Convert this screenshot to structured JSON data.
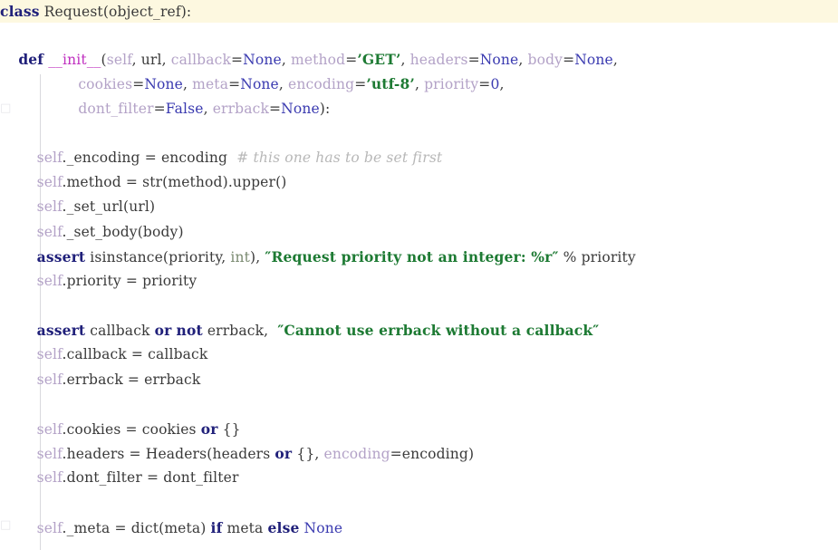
{
  "editor": {
    "language": "python",
    "highlighted_line_number": 1,
    "colors": {
      "background": "#ffffff",
      "current_line_highlight": "#fdf8e0",
      "keyword": "#20207a",
      "string": "#1d7a33",
      "constant": "#3a3ab0",
      "self_param": "#b3a2c7",
      "function_name": "#c030c0",
      "comment": "#b8b8b8",
      "type_name": "#7a8a70",
      "plain_text": "#3a3a3a",
      "indent_guide": "#d9d9dd"
    },
    "gutter_ghosts": [
      "□",
      "□"
    ]
  },
  "code": {
    "lines": [
      {
        "id": "line-class-request",
        "highlighted": true,
        "tokens": [
          {
            "cls": "t-kw",
            "text": "class"
          },
          {
            "cls": "t-op",
            "text": " "
          },
          {
            "cls": "t-name",
            "text": "Request"
          },
          {
            "cls": "t-punct",
            "text": "("
          },
          {
            "cls": "t-name",
            "text": "object_ref"
          },
          {
            "cls": "t-punct",
            "text": "):"
          }
        ]
      },
      {
        "id": "line-blank-1",
        "tokens": []
      },
      {
        "id": "line-def-init",
        "tokens": [
          {
            "cls": "t-op",
            "text": "    "
          },
          {
            "cls": "t-kw",
            "text": "def"
          },
          {
            "cls": "t-op",
            "text": " "
          },
          {
            "cls": "t-fname",
            "text": "__init__"
          },
          {
            "cls": "t-punct",
            "text": "("
          },
          {
            "cls": "t-self",
            "text": "self"
          },
          {
            "cls": "t-punct",
            "text": ", "
          },
          {
            "cls": "t-name",
            "text": "url"
          },
          {
            "cls": "t-punct",
            "text": ", "
          },
          {
            "cls": "t-kwarg",
            "text": "callback"
          },
          {
            "cls": "t-op",
            "text": "="
          },
          {
            "cls": "t-const",
            "text": "None"
          },
          {
            "cls": "t-punct",
            "text": ", "
          },
          {
            "cls": "t-kwarg",
            "text": "method"
          },
          {
            "cls": "t-op",
            "text": "="
          },
          {
            "cls": "t-str",
            "text": "’GET’"
          },
          {
            "cls": "t-punct",
            "text": ", "
          },
          {
            "cls": "t-kwarg",
            "text": "headers"
          },
          {
            "cls": "t-op",
            "text": "="
          },
          {
            "cls": "t-const",
            "text": "None"
          },
          {
            "cls": "t-punct",
            "text": ", "
          },
          {
            "cls": "t-kwarg",
            "text": "body"
          },
          {
            "cls": "t-op",
            "text": "="
          },
          {
            "cls": "t-const",
            "text": "None"
          },
          {
            "cls": "t-punct",
            "text": ","
          }
        ]
      },
      {
        "id": "line-def-init-cont-1",
        "tokens": [
          {
            "cls": "t-op",
            "text": "                 "
          },
          {
            "cls": "t-kwarg",
            "text": "cookies"
          },
          {
            "cls": "t-op",
            "text": "="
          },
          {
            "cls": "t-const",
            "text": "None"
          },
          {
            "cls": "t-punct",
            "text": ", "
          },
          {
            "cls": "t-kwarg",
            "text": "meta"
          },
          {
            "cls": "t-op",
            "text": "="
          },
          {
            "cls": "t-const",
            "text": "None"
          },
          {
            "cls": "t-punct",
            "text": ", "
          },
          {
            "cls": "t-kwarg",
            "text": "encoding"
          },
          {
            "cls": "t-op",
            "text": "="
          },
          {
            "cls": "t-str",
            "text": "’utf-8’"
          },
          {
            "cls": "t-punct",
            "text": ", "
          },
          {
            "cls": "t-kwarg",
            "text": "priority"
          },
          {
            "cls": "t-op",
            "text": "="
          },
          {
            "cls": "t-num",
            "text": "0"
          },
          {
            "cls": "t-punct",
            "text": ","
          }
        ]
      },
      {
        "id": "line-def-init-cont-2",
        "tokens": [
          {
            "cls": "t-op",
            "text": "                 "
          },
          {
            "cls": "t-kwarg",
            "text": "dont_filter"
          },
          {
            "cls": "t-op",
            "text": "="
          },
          {
            "cls": "t-const",
            "text": "False"
          },
          {
            "cls": "t-punct",
            "text": ", "
          },
          {
            "cls": "t-kwarg",
            "text": "errback"
          },
          {
            "cls": "t-op",
            "text": "="
          },
          {
            "cls": "t-const",
            "text": "None"
          },
          {
            "cls": "t-punct",
            "text": "):"
          }
        ]
      },
      {
        "id": "line-blank-2",
        "tokens": []
      },
      {
        "id": "line-self-encoding",
        "tokens": [
          {
            "cls": "t-op",
            "text": "        "
          },
          {
            "cls": "t-self",
            "text": "self"
          },
          {
            "cls": "t-punct",
            "text": "."
          },
          {
            "cls": "t-name",
            "text": "_encoding"
          },
          {
            "cls": "t-op",
            "text": " = "
          },
          {
            "cls": "t-name",
            "text": "encoding"
          },
          {
            "cls": "t-op",
            "text": "  "
          },
          {
            "cls": "t-comment",
            "text": "# this one has to be set first"
          }
        ]
      },
      {
        "id": "line-self-method",
        "tokens": [
          {
            "cls": "t-op",
            "text": "        "
          },
          {
            "cls": "t-self",
            "text": "self"
          },
          {
            "cls": "t-punct",
            "text": "."
          },
          {
            "cls": "t-name",
            "text": "method"
          },
          {
            "cls": "t-op",
            "text": " = "
          },
          {
            "cls": "t-builtin",
            "text": "str"
          },
          {
            "cls": "t-punct",
            "text": "("
          },
          {
            "cls": "t-name",
            "text": "method"
          },
          {
            "cls": "t-punct",
            "text": ")."
          },
          {
            "cls": "t-name",
            "text": "upper"
          },
          {
            "cls": "t-punct",
            "text": "()"
          }
        ]
      },
      {
        "id": "line-self-set-url",
        "tokens": [
          {
            "cls": "t-op",
            "text": "        "
          },
          {
            "cls": "t-self",
            "text": "self"
          },
          {
            "cls": "t-punct",
            "text": "."
          },
          {
            "cls": "t-name",
            "text": "_set_url"
          },
          {
            "cls": "t-punct",
            "text": "("
          },
          {
            "cls": "t-name",
            "text": "url"
          },
          {
            "cls": "t-punct",
            "text": ")"
          }
        ]
      },
      {
        "id": "line-self-set-body",
        "tokens": [
          {
            "cls": "t-op",
            "text": "        "
          },
          {
            "cls": "t-self",
            "text": "self"
          },
          {
            "cls": "t-punct",
            "text": "."
          },
          {
            "cls": "t-name",
            "text": "_set_body"
          },
          {
            "cls": "t-punct",
            "text": "("
          },
          {
            "cls": "t-name",
            "text": "body"
          },
          {
            "cls": "t-punct",
            "text": ")"
          }
        ]
      },
      {
        "id": "line-assert-priority",
        "tokens": [
          {
            "cls": "t-op",
            "text": "        "
          },
          {
            "cls": "t-kw",
            "text": "assert"
          },
          {
            "cls": "t-op",
            "text": " "
          },
          {
            "cls": "t-builtin",
            "text": "isinstance"
          },
          {
            "cls": "t-punct",
            "text": "("
          },
          {
            "cls": "t-name",
            "text": "priority"
          },
          {
            "cls": "t-punct",
            "text": ", "
          },
          {
            "cls": "t-type",
            "text": "int"
          },
          {
            "cls": "t-punct",
            "text": "), "
          },
          {
            "cls": "t-str",
            "text": "″Request priority not an integer: %r″"
          },
          {
            "cls": "t-op",
            "text": " % "
          },
          {
            "cls": "t-name",
            "text": "priority"
          }
        ]
      },
      {
        "id": "line-self-priority",
        "tokens": [
          {
            "cls": "t-op",
            "text": "        "
          },
          {
            "cls": "t-self",
            "text": "self"
          },
          {
            "cls": "t-punct",
            "text": "."
          },
          {
            "cls": "t-name",
            "text": "priority"
          },
          {
            "cls": "t-op",
            "text": " = "
          },
          {
            "cls": "t-name",
            "text": "priority"
          }
        ]
      },
      {
        "id": "line-blank-3",
        "tokens": []
      },
      {
        "id": "line-assert-callback",
        "tokens": [
          {
            "cls": "t-op",
            "text": "        "
          },
          {
            "cls": "t-kw",
            "text": "assert"
          },
          {
            "cls": "t-op",
            "text": " "
          },
          {
            "cls": "t-name",
            "text": "callback"
          },
          {
            "cls": "t-op",
            "text": " "
          },
          {
            "cls": "t-kw",
            "text": "or"
          },
          {
            "cls": "t-op",
            "text": " "
          },
          {
            "cls": "t-kw",
            "text": "not"
          },
          {
            "cls": "t-op",
            "text": " "
          },
          {
            "cls": "t-name",
            "text": "errback"
          },
          {
            "cls": "t-punct",
            "text": ",  "
          },
          {
            "cls": "t-str",
            "text": "″Cannot use errback without a callback″"
          }
        ]
      },
      {
        "id": "line-self-callback",
        "tokens": [
          {
            "cls": "t-op",
            "text": "        "
          },
          {
            "cls": "t-self",
            "text": "self"
          },
          {
            "cls": "t-punct",
            "text": "."
          },
          {
            "cls": "t-name",
            "text": "callback"
          },
          {
            "cls": "t-op",
            "text": " = "
          },
          {
            "cls": "t-name",
            "text": "callback"
          }
        ]
      },
      {
        "id": "line-self-errback",
        "tokens": [
          {
            "cls": "t-op",
            "text": "        "
          },
          {
            "cls": "t-self",
            "text": "self"
          },
          {
            "cls": "t-punct",
            "text": "."
          },
          {
            "cls": "t-name",
            "text": "errback"
          },
          {
            "cls": "t-op",
            "text": " = "
          },
          {
            "cls": "t-name",
            "text": "errback"
          }
        ]
      },
      {
        "id": "line-blank-4",
        "tokens": []
      },
      {
        "id": "line-self-cookies",
        "tokens": [
          {
            "cls": "t-op",
            "text": "        "
          },
          {
            "cls": "t-self",
            "text": "self"
          },
          {
            "cls": "t-punct",
            "text": "."
          },
          {
            "cls": "t-name",
            "text": "cookies"
          },
          {
            "cls": "t-op",
            "text": " = "
          },
          {
            "cls": "t-name",
            "text": "cookies"
          },
          {
            "cls": "t-op",
            "text": " "
          },
          {
            "cls": "t-kw",
            "text": "or"
          },
          {
            "cls": "t-op",
            "text": " "
          },
          {
            "cls": "t-punct",
            "text": "{}"
          }
        ]
      },
      {
        "id": "line-self-headers",
        "tokens": [
          {
            "cls": "t-op",
            "text": "        "
          },
          {
            "cls": "t-self",
            "text": "self"
          },
          {
            "cls": "t-punct",
            "text": "."
          },
          {
            "cls": "t-name",
            "text": "headers"
          },
          {
            "cls": "t-op",
            "text": " = "
          },
          {
            "cls": "t-name",
            "text": "Headers"
          },
          {
            "cls": "t-punct",
            "text": "("
          },
          {
            "cls": "t-name",
            "text": "headers"
          },
          {
            "cls": "t-op",
            "text": " "
          },
          {
            "cls": "t-kw",
            "text": "or"
          },
          {
            "cls": "t-op",
            "text": " "
          },
          {
            "cls": "t-punct",
            "text": "{}, "
          },
          {
            "cls": "t-kwarg",
            "text": "encoding"
          },
          {
            "cls": "t-op",
            "text": "="
          },
          {
            "cls": "t-name",
            "text": "encoding"
          },
          {
            "cls": "t-punct",
            "text": ")"
          }
        ]
      },
      {
        "id": "line-self-dont-filter",
        "tokens": [
          {
            "cls": "t-op",
            "text": "        "
          },
          {
            "cls": "t-self",
            "text": "self"
          },
          {
            "cls": "t-punct",
            "text": "."
          },
          {
            "cls": "t-name",
            "text": "dont_filter"
          },
          {
            "cls": "t-op",
            "text": " = "
          },
          {
            "cls": "t-name",
            "text": "dont_filter"
          }
        ]
      },
      {
        "id": "line-blank-5",
        "tokens": []
      },
      {
        "id": "line-self-meta",
        "tokens": [
          {
            "cls": "t-op",
            "text": "        "
          },
          {
            "cls": "t-self",
            "text": "self"
          },
          {
            "cls": "t-punct",
            "text": "."
          },
          {
            "cls": "t-name",
            "text": "_meta"
          },
          {
            "cls": "t-op",
            "text": " = "
          },
          {
            "cls": "t-builtin",
            "text": "dict"
          },
          {
            "cls": "t-punct",
            "text": "("
          },
          {
            "cls": "t-name",
            "text": "meta"
          },
          {
            "cls": "t-punct",
            "text": ") "
          },
          {
            "cls": "t-kw",
            "text": "if"
          },
          {
            "cls": "t-op",
            "text": " "
          },
          {
            "cls": "t-name",
            "text": "meta"
          },
          {
            "cls": "t-op",
            "text": " "
          },
          {
            "cls": "t-kw",
            "text": "else"
          },
          {
            "cls": "t-op",
            "text": " "
          },
          {
            "cls": "t-const",
            "text": "None"
          }
        ]
      }
    ]
  }
}
